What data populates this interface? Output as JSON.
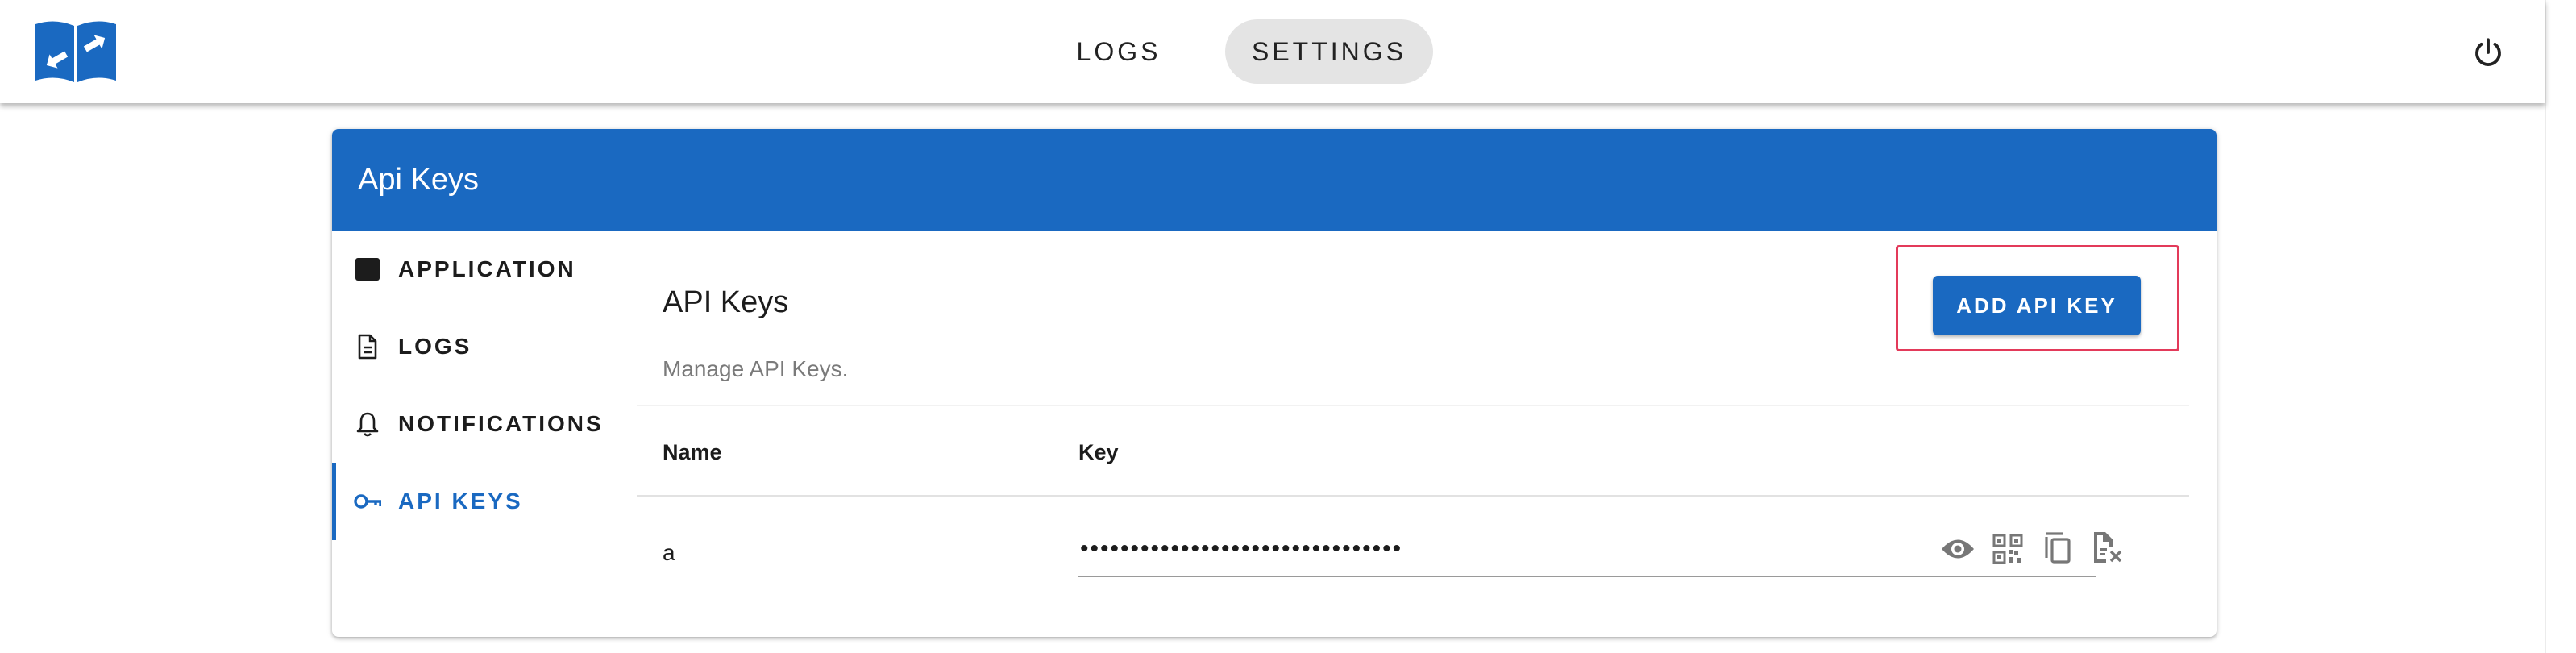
{
  "nav": {
    "logs_label": "LOGS",
    "settings_label": "SETTINGS",
    "active_tab": "SETTINGS"
  },
  "icons": {
    "logo": "app-logo-icon",
    "power": "power-icon",
    "application": "window-icon",
    "logs": "file-document-icon",
    "notifications": "bell-icon",
    "api_keys": "key-icon",
    "reveal": "eye-icon",
    "qr": "qr-code-icon",
    "copy": "copy-icon",
    "delete": "file-remove-icon"
  },
  "colors": {
    "primary": "#1a69c1",
    "highlight": "#e33a5a",
    "active_tab_bg": "#e4e4e4"
  },
  "card": {
    "header_title": "Api Keys"
  },
  "sidebar": {
    "items": [
      {
        "label": "APPLICATION",
        "active": false
      },
      {
        "label": "LOGS",
        "active": false
      },
      {
        "label": "NOTIFICATIONS",
        "active": false
      },
      {
        "label": "API KEYS",
        "active": true
      }
    ]
  },
  "content": {
    "title": "API Keys",
    "subtitle": "Manage API Keys.",
    "add_button_label": "ADD API KEY",
    "table": {
      "columns": [
        "Name",
        "Key"
      ],
      "rows": [
        {
          "name": "a",
          "key_masked": "••••••••••••••••••••••••••••••••"
        }
      ]
    }
  }
}
